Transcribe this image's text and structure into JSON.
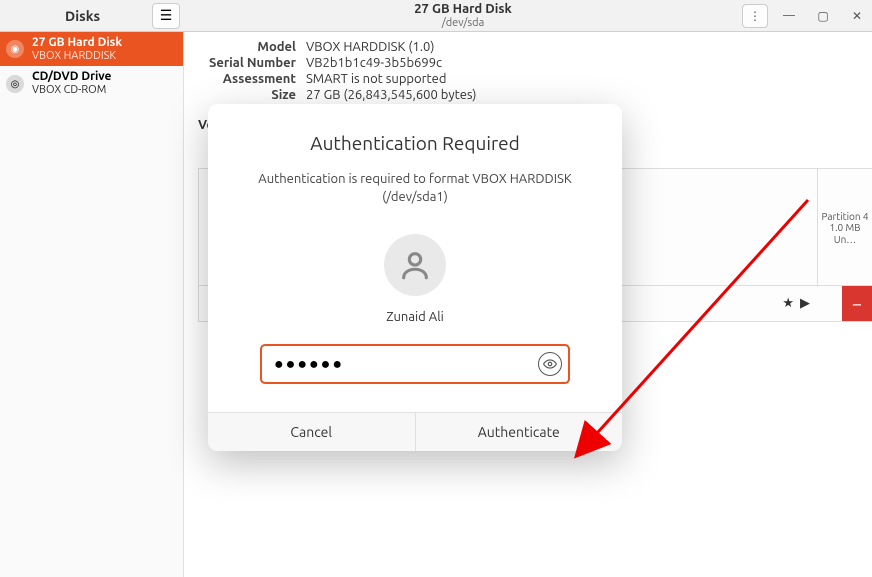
{
  "header": {
    "app_title": "Disks",
    "device_title": "27 GB Hard Disk",
    "device_path": "/dev/sda"
  },
  "sidebar": {
    "items": [
      {
        "title": "27 GB Hard Disk",
        "sub": "VBOX HARDDISK"
      },
      {
        "title": "CD/DVD Drive",
        "sub": "VBOX CD-ROM"
      }
    ]
  },
  "info": {
    "model_label": "Model",
    "model_value": "VBOX HARDDISK (1.0)",
    "serial_label": "Serial Number",
    "serial_value": "VB2b1b1c49-3b5b699c",
    "assessment_label": "Assessment",
    "assessment_value": "SMART is not supported",
    "size_label": "Size",
    "size_value": "27 GB (26,843,545,600 bytes)"
  },
  "volumes": {
    "section_label": "Volumes",
    "partition4": {
      "label": "Partition 4",
      "size": "1.0 MB Un…"
    }
  },
  "dialog": {
    "title": "Authentication Required",
    "message": "Authentication is required to format VBOX HARDDISK (/dev/sda1)",
    "user": "Zunaid Ali",
    "password_value": "●●●●●●",
    "cancel_label": "Cancel",
    "auth_label": "Authenticate"
  }
}
